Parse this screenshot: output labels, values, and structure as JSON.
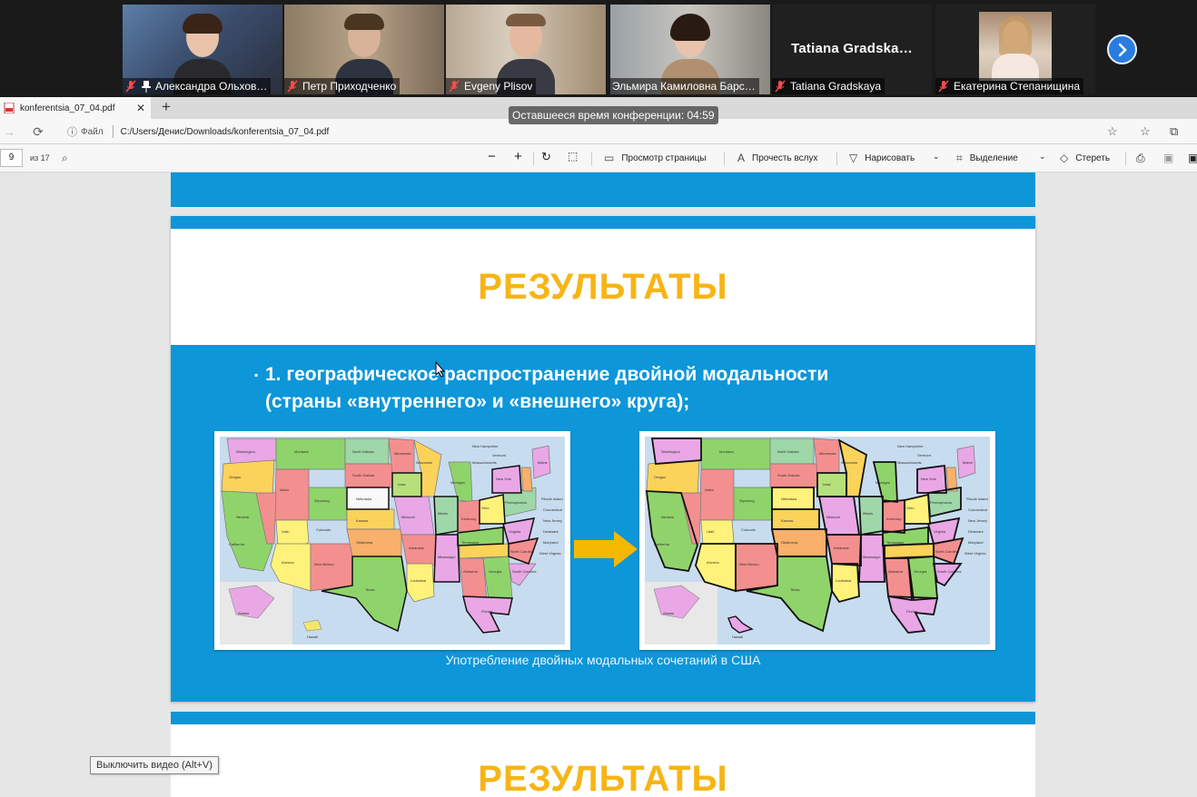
{
  "participants": [
    {
      "name": "Александра Ольхов…",
      "muted": true,
      "pinned": true
    },
    {
      "name": "Петр Приходченко",
      "muted": true
    },
    {
      "name": "Evgeny Plisov",
      "muted": true,
      "active": true
    },
    {
      "name": "Эльмира Камиловна Барс…",
      "muted": false
    },
    {
      "name": "Tatiana Gradskaya",
      "display_name": "Tatiana  Gradska…",
      "muted": true,
      "video": false
    },
    {
      "name": "Екатерина Степанищина",
      "muted": true
    }
  ],
  "timer_text": "Оставшееся время конференции: 04:59",
  "browser": {
    "tab_title": "konferentsia_07_04.pdf",
    "file_label": "Файл",
    "url": "C:/Users/Денис/Downloads/konferentsia_07_04.pdf"
  },
  "pdf_toolbar": {
    "page": "9",
    "of_total": "из 17",
    "page_view": "Просмотр страницы",
    "read_aloud": "Прочесть вслух",
    "draw": "Нарисовать",
    "highlight": "Выделение",
    "erase": "Стереть"
  },
  "slide": {
    "title": "РЕЗУЛЬТАТЫ",
    "bullet_line1": "1. географическое распространение двойной модальности",
    "bullet_line2": "(страны «внутреннего» и «внешнего» круга);",
    "caption": "Употребление двойных модальных сочетаний в США"
  },
  "next_slide": {
    "title": "РЕЗУЛЬТАТЫ"
  },
  "tooltip": "Выключить видео (Alt+V)",
  "colors": {
    "slide_blue": "#0d96d8",
    "title_yellow": "#f7b515",
    "arrow_yellow": "#f5b800",
    "zoom_blue": "#2a7ce0"
  }
}
